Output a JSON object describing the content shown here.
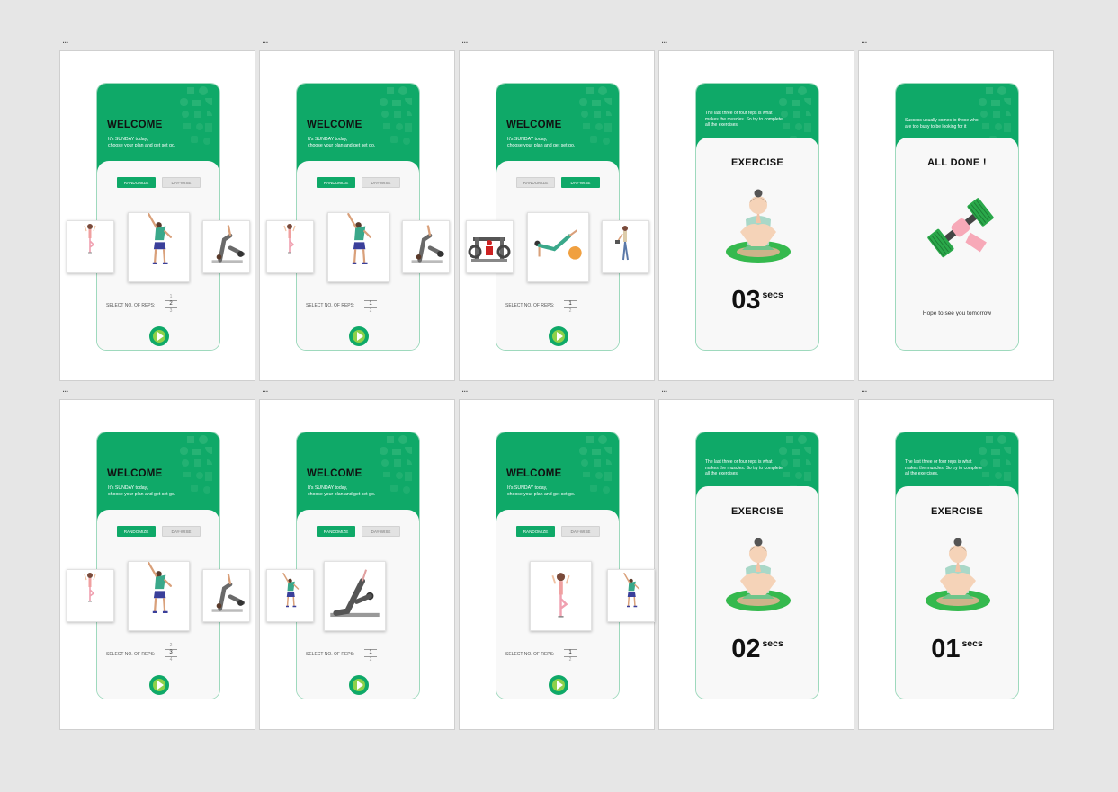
{
  "artboard_menu": "...",
  "home": {
    "title": "WELCOME",
    "subtitle_line1": "It's SUNDAY today,",
    "subtitle_line2": "choose your plan and get set go.",
    "randomize": "RANDOMIZE",
    "daywise": "DAY-WISE",
    "reps_label": "SELECT NO. OF REPS:"
  },
  "exercise": {
    "quote_line1": "The last three or four reps is what",
    "quote_line2": "makes the muscles. So try to complete",
    "quote_line3": "all the exercises.",
    "title": "EXERCISE",
    "unit": "secs"
  },
  "done": {
    "quote_line1": "Success usually comes to those who",
    "quote_line2": "are too busy to be looking for it",
    "title": "ALL DONE !",
    "message": "Hope to see you tomorrow"
  },
  "screens": [
    {
      "reps": [
        "1",
        "2",
        "3"
      ],
      "mode": "randomize"
    },
    {
      "reps": [
        "",
        "1",
        "2"
      ],
      "mode": "randomize"
    },
    {
      "reps": [
        "",
        "1",
        "2"
      ],
      "mode": "daywise"
    },
    {
      "counter": "03"
    },
    {},
    {
      "reps": [
        "2",
        "3",
        "4"
      ],
      "mode": "randomize"
    },
    {
      "reps": [
        "",
        "1",
        "2"
      ],
      "mode": "randomize"
    },
    {
      "reps": [
        "",
        "1",
        "2"
      ],
      "mode": "randomize"
    },
    {
      "counter": "02"
    },
    {
      "counter": "01"
    }
  ],
  "colors": {
    "brand_green": "#0fa968",
    "accent_lime": "#8ed14a",
    "panel": "#f8f8f8"
  }
}
